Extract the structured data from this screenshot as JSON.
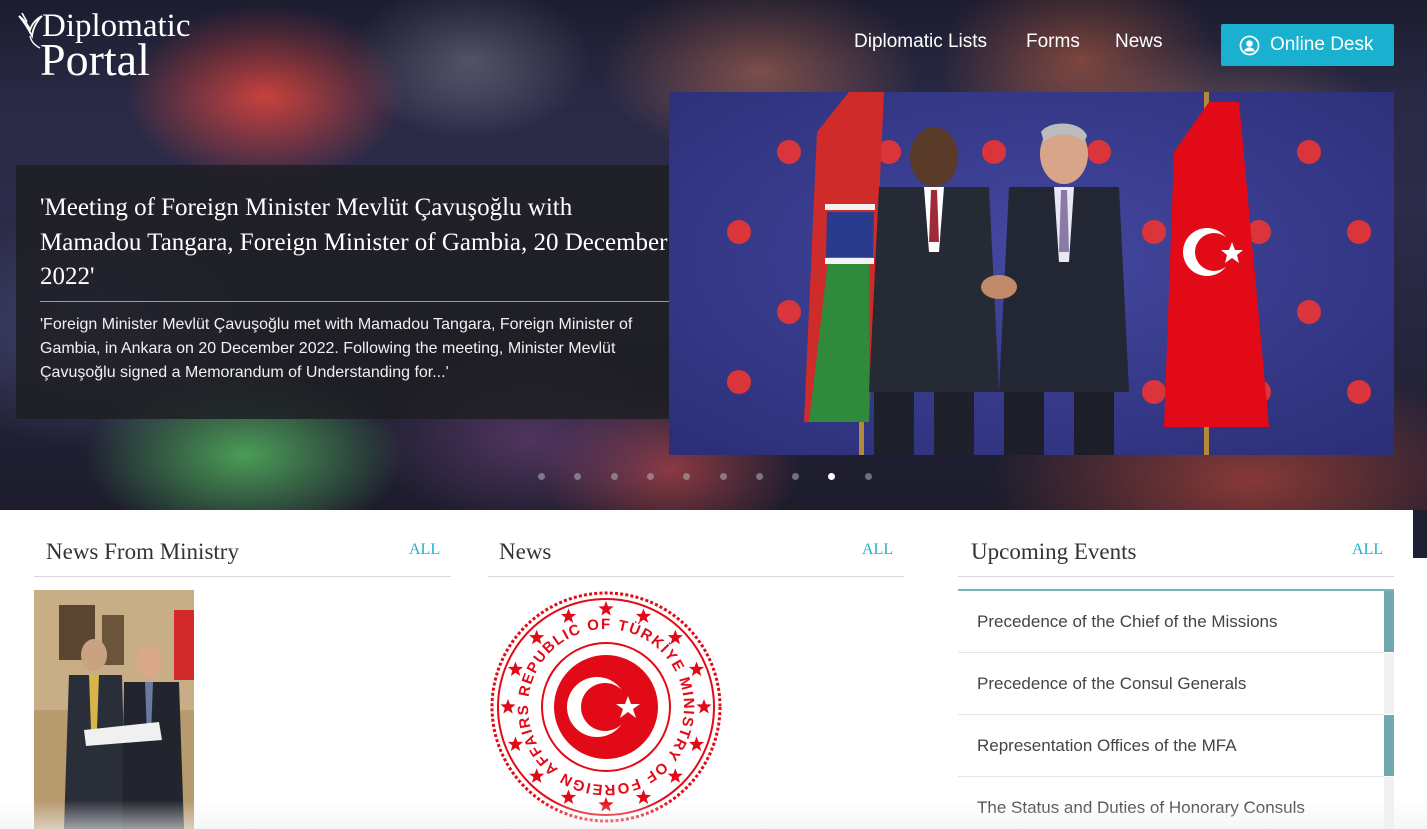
{
  "brand": {
    "line1": "Diplomatic",
    "line2": "Portal"
  },
  "nav": {
    "items": [
      "Diplomatic Lists",
      "Forms",
      "News"
    ],
    "online_desk": "Online Desk"
  },
  "hero": {
    "title": "'Meeting of Foreign Minister Mevlüt Çavuşoğlu with Mamadou Tangara, Foreign Minister of Gambia, 20 December 2022'",
    "summary": "'Foreign Minister Mevlüt Çavuşoğlu met with Mamadou Tangara, Foreign Minister of Gambia, in Ankara on 20 December 2022. Following the meeting, Minister Mevlüt Çavuşoğlu signed a Memorandum of Understanding for...'",
    "slide_count": 10,
    "active_slide": 9
  },
  "sections": {
    "ministry": {
      "title": "News From Ministry",
      "all": "ALL"
    },
    "news": {
      "title": "News",
      "all": "ALL"
    },
    "events": {
      "title": "Upcoming Events",
      "all": "ALL",
      "items": [
        "Precedence of the Chief of the Missions",
        "Precedence of the Consul Generals",
        "Representation Offices of the MFA",
        "The Status and Duties of Honorary Consuls"
      ]
    }
  },
  "seal_text": "REPUBLIC OF TÜRKİYE MINISTRY OF FOREIGN AFFAIRS",
  "colors": {
    "accent": "#1ab1d1",
    "turkey_red": "#e30a17",
    "event_bar": "#6fa9ad"
  }
}
